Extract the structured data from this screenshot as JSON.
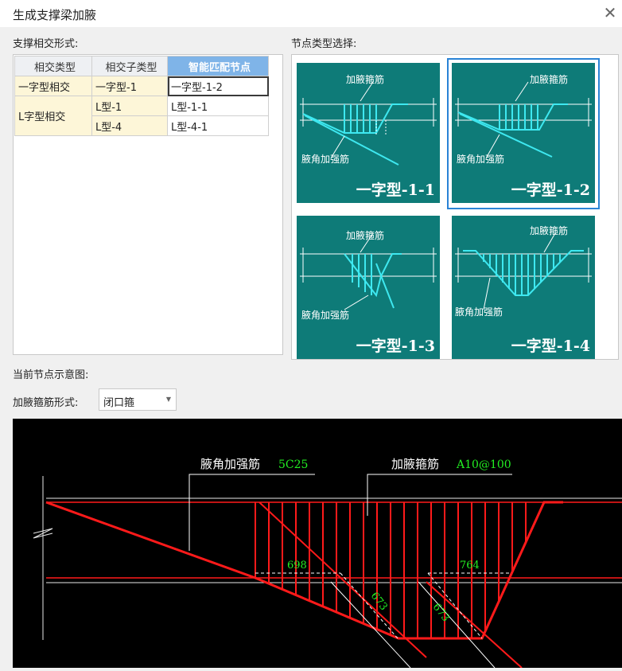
{
  "window": {
    "title": "生成支撑梁加腋",
    "close_glyph": "✕"
  },
  "left": {
    "section_label": "支撑相交形式:",
    "columns": [
      "相交类型",
      "相交子类型",
      "智能匹配节点"
    ],
    "groups": [
      {
        "type": "一字型相交",
        "rows": [
          {
            "sub": "一字型-1",
            "node": "一字型-1-2"
          }
        ]
      },
      {
        "type": "L字型相交",
        "rows": [
          {
            "sub": "L型-1",
            "node": "L型-1-1"
          },
          {
            "sub": "L型-4",
            "node": "L型-4-1"
          }
        ]
      }
    ]
  },
  "right": {
    "section_label": "节点类型选择:",
    "thumbs": [
      {
        "label": "一字型-1-1",
        "top_note": "加腋箍筋",
        "bottom_note": "腋角加强筋"
      },
      {
        "label": "一字型-1-2",
        "top_note": "加腋箍筋",
        "bottom_note": "腋角加强筋",
        "selected": true
      },
      {
        "label": "一字型-1-3",
        "top_note": "加腋箍筋",
        "bottom_note": "腋角加强筋"
      },
      {
        "label": "一字型-1-4",
        "top_note": "加腋箍筋",
        "bottom_note": "腋角加强筋"
      }
    ],
    "thumb_color": "#0e7b78"
  },
  "preview": {
    "section_label": "当前节点示意图:",
    "stirrup_form_label": "加腋箍筋形式:",
    "stirrup_form_value": "闭口箍",
    "rebar_label": "腋角加强筋",
    "rebar_value": "5C25",
    "stirrup_label": "加腋箍筋",
    "stirrup_value": "A10@100",
    "dims": {
      "left": "698",
      "right": "764",
      "diag_left": "673",
      "diag_right": "673"
    }
  }
}
